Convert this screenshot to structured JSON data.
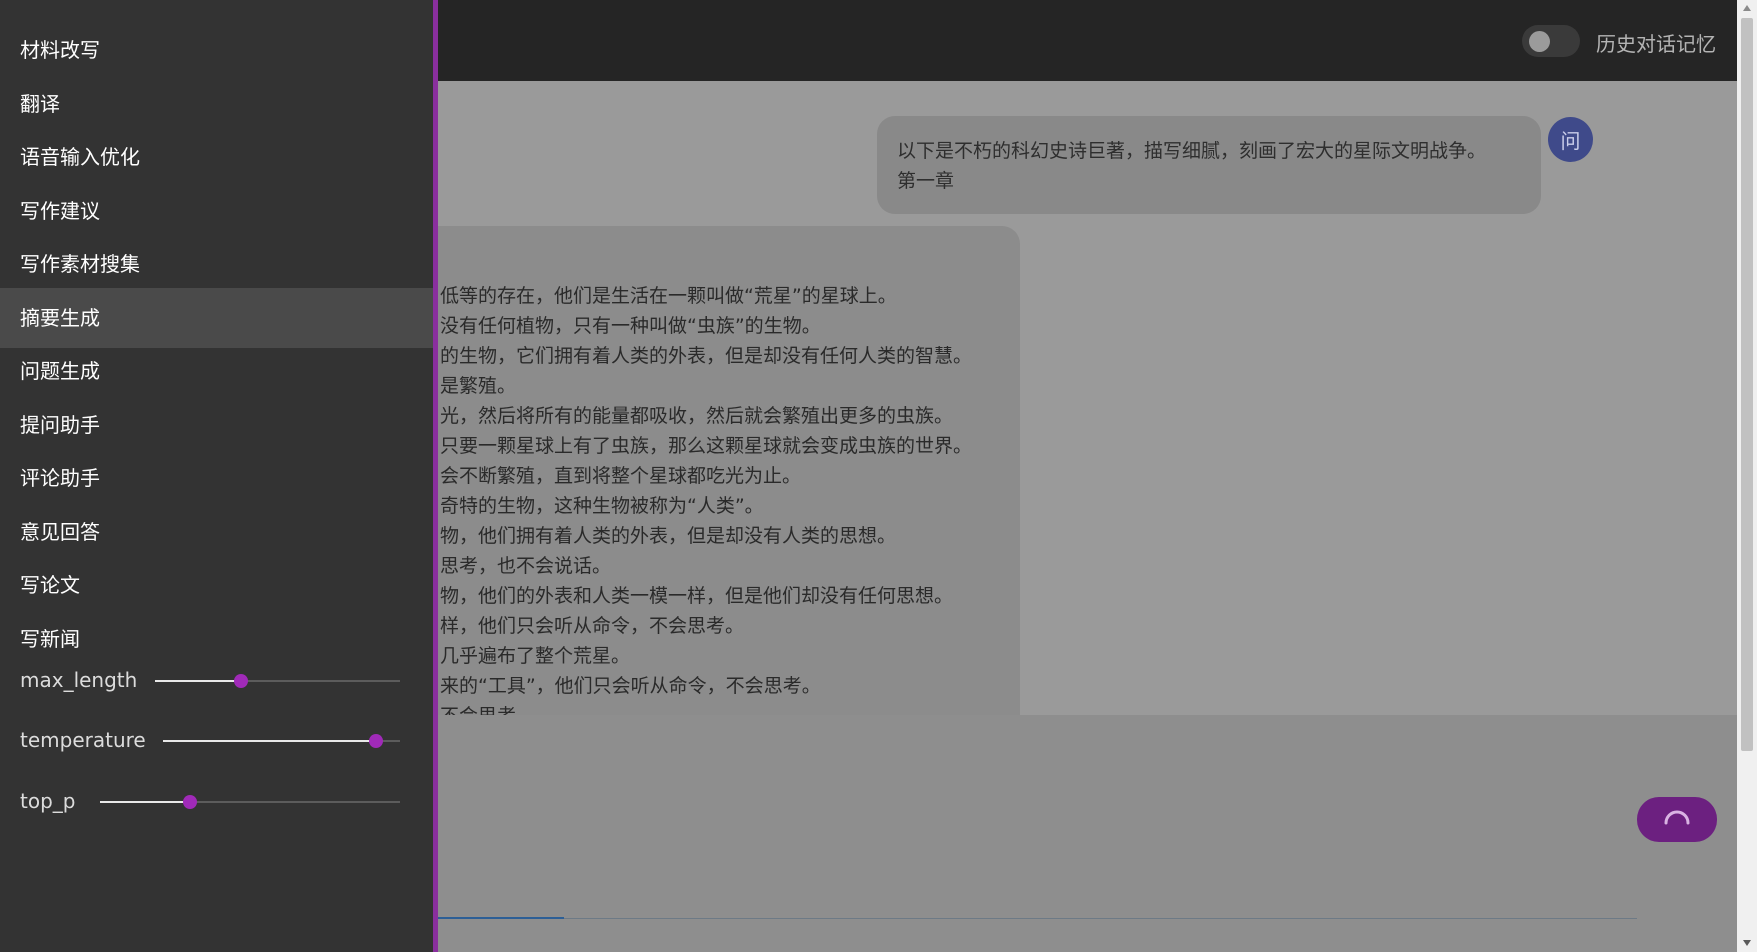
{
  "header": {
    "history_toggle_label": "历史对话记忆",
    "history_toggle_on": false
  },
  "chat": {
    "user_avatar_label": "问",
    "user_message_lines": [
      "以下是不朽的科幻史诗巨著，描写细腻，刻画了宏大的星际文明战争。",
      "第一章"
    ],
    "bot_message_lines": [
      "低等的存在，他们是生活在一颗叫做“荒星”的星球上。",
      "没有任何植物，只有一种叫做“虫族”的生物。",
      "的生物，它们拥有着人类的外表，但是却没有任何人类的智慧。",
      "是繁殖。",
      "光，然后将所有的能量都吸收，然后就会繁殖出更多的虫族。",
      "只要一颗星球上有了虫族，那么这颗星球就会变成虫族的世界。",
      "会不断繁殖，直到将整个星球都吃光为止。",
      "奇特的生物，这种生物被称为“人类”。",
      "物，他们拥有着人类的外表，但是却没有人类的思想。",
      "思考，也不会说话。",
      "物，他们的外表和人类一模一样，但是他们却没有任何思想。",
      "样，他们只会听从命令，不会思考。",
      "几乎遍布了整个荒星。",
      "来的“工具”，他们只会听从命令，不会思考。",
      "不会思考"
    ]
  },
  "drawer": {
    "menu_items": [
      {
        "label": "材料改写",
        "active": false
      },
      {
        "label": "翻译",
        "active": false
      },
      {
        "label": "语音输入优化",
        "active": false
      },
      {
        "label": "写作建议",
        "active": false
      },
      {
        "label": "写作素材搜集",
        "active": false
      },
      {
        "label": "摘要生成",
        "active": true
      },
      {
        "label": "问题生成",
        "active": false
      },
      {
        "label": "提问助手",
        "active": false
      },
      {
        "label": "评论助手",
        "active": false
      },
      {
        "label": "意见回答",
        "active": false
      },
      {
        "label": "写论文",
        "active": false
      },
      {
        "label": "写新闻",
        "active": false
      }
    ],
    "sliders": [
      {
        "label": "max_length",
        "value_fraction": 0.35
      },
      {
        "label": "temperature",
        "value_fraction": 0.9
      },
      {
        "label": "top_p",
        "value_fraction": 0.3
      }
    ]
  },
  "colors": {
    "accent": "#a02ab8",
    "send_button": "#6c2080",
    "drawer_bg": "#333333"
  }
}
